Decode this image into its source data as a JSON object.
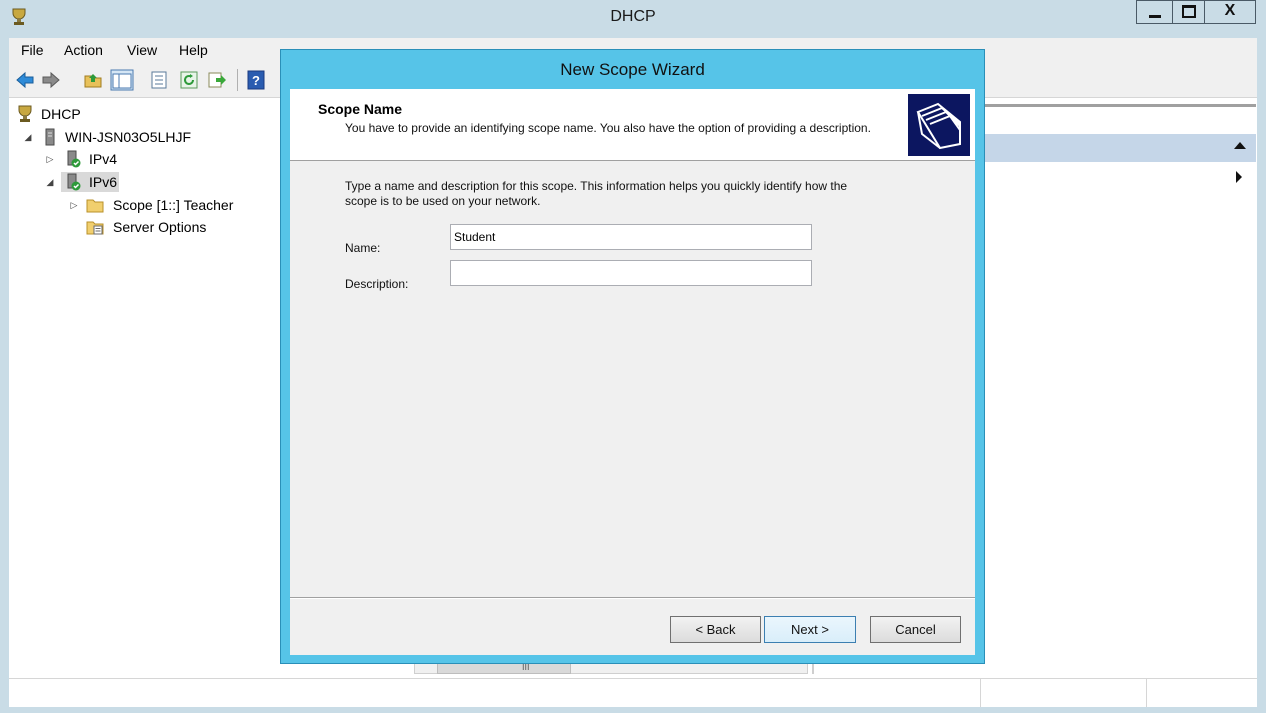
{
  "window": {
    "title": "DHCP",
    "close_glyph": "X",
    "icons": [
      "dhcp-app-icon",
      "minimize-icon",
      "maximize-icon",
      "close-icon"
    ]
  },
  "menu": [
    "File",
    "Action",
    "View",
    "Help"
  ],
  "toolbar": {
    "icons": [
      "back-arrow-icon",
      "forward-arrow-icon",
      "up-folder-icon",
      "show-hide-tree-icon",
      "properties-icon",
      "refresh-icon",
      "export-list-icon",
      "help-icon"
    ]
  },
  "tree": {
    "root": "DHCP",
    "server": "WIN-JSN03O5LHJF",
    "ipv4": "IPv4",
    "ipv6": "IPv6",
    "scope": "Scope [1::] Teacher",
    "server_options": "Server Options"
  },
  "hscroll": {
    "grip": "III"
  },
  "wizard": {
    "title": "New Scope Wizard",
    "heading": "Scope Name",
    "subtext": "You have to provide an identifying scope name. You also have the option of providing a description.",
    "instructions": "Type a name and description for this scope. This information helps you quickly identify how the scope is to be used on your network.",
    "name_label": "Name:",
    "name_value": "Student",
    "description_label": "Description:",
    "description_value": "",
    "back_label": "< Back",
    "next_label": "Next >",
    "cancel_label": "Cancel",
    "header_image": "scope-folder-icon",
    "colors": {
      "frame": "#56c4e8",
      "image_bg": "#0c1660",
      "selection": "#c5d6e8"
    }
  }
}
